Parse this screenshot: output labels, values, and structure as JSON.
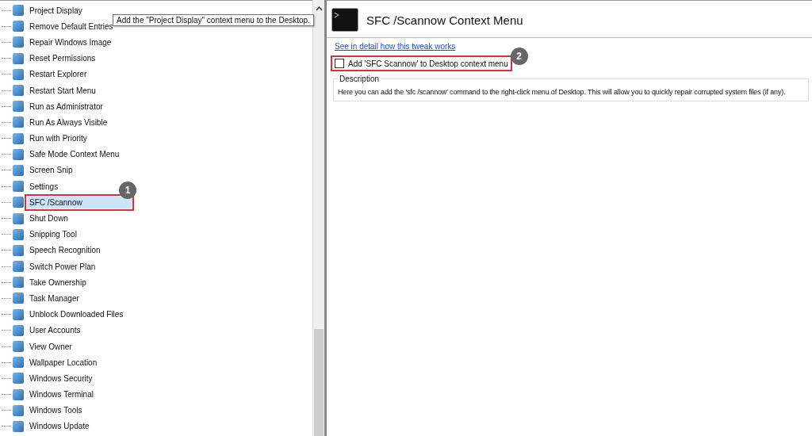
{
  "tree": {
    "items": [
      {
        "label": "Project Display",
        "selected": false
      },
      {
        "label": "Remove Default Entries",
        "selected": false
      },
      {
        "label": "Repair Windows Image",
        "selected": false
      },
      {
        "label": "Reset Permissions",
        "selected": false
      },
      {
        "label": "Restart Explorer",
        "selected": false
      },
      {
        "label": "Restart Start Menu",
        "selected": false
      },
      {
        "label": "Run as Administrator",
        "selected": false
      },
      {
        "label": "Run As Always Visible",
        "selected": false
      },
      {
        "label": "Run with Priority",
        "selected": false
      },
      {
        "label": "Safe Mode Context Menu",
        "selected": false
      },
      {
        "label": "Screen Snip",
        "selected": false
      },
      {
        "label": "Settings",
        "selected": false
      },
      {
        "label": "SFC /Scannow",
        "selected": true,
        "callout": "1"
      },
      {
        "label": "Shut Down",
        "selected": false
      },
      {
        "label": "Snipping Tool",
        "selected": false
      },
      {
        "label": "Speech Recognition",
        "selected": false
      },
      {
        "label": "Switch Power Plan",
        "selected": false
      },
      {
        "label": "Take Ownership",
        "selected": false
      },
      {
        "label": "Task Manager",
        "selected": false
      },
      {
        "label": "Unblock Downloaded Files",
        "selected": false
      },
      {
        "label": "User Accounts",
        "selected": false
      },
      {
        "label": "View Owner",
        "selected": false
      },
      {
        "label": "Wallpaper Location",
        "selected": false
      },
      {
        "label": "Windows Security",
        "selected": false
      },
      {
        "label": "Windows Terminal",
        "selected": false
      },
      {
        "label": "Windows Tools",
        "selected": false
      },
      {
        "label": "Windows Update",
        "selected": false
      }
    ],
    "tooltip": "Add the \"Project Display\" context menu to the Desktop."
  },
  "detail": {
    "title": "SFC /Scannow Context Menu",
    "link": "See in detail how this tweak works",
    "option": {
      "label": "Add 'SFC Scannow' to Desktop context menu",
      "checked": false,
      "callout": "2"
    },
    "description": {
      "legend": "Description",
      "text": "Here you can add the 'sfc /scannow' command to the right-click menu of Desktop. This will allow you to quickly repair corrupted system files (if any)."
    }
  }
}
